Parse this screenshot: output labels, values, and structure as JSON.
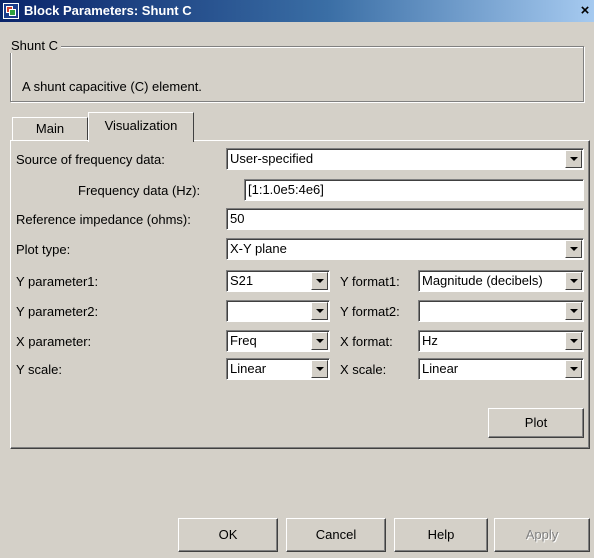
{
  "window": {
    "title": "Block Parameters: Shunt C",
    "close_label": "×"
  },
  "group": {
    "legend": "Shunt C",
    "description": "A shunt capacitive (C) element."
  },
  "tabs": [
    {
      "label": "Main",
      "selected": false
    },
    {
      "label": "Visualization",
      "selected": true
    }
  ],
  "form": {
    "source_label": "Source of frequency data:",
    "source_value": "User-specified",
    "freq_label": "Frequency data (Hz):",
    "freq_value": "[1:1.0e5:4e6]",
    "refimp_label": "Reference impedance (ohms):",
    "refimp_value": "50",
    "plottype_label": "Plot type:",
    "plottype_value": "X-Y plane",
    "yparam1_label": "Y parameter1:",
    "yparam1_value": "S21",
    "yformat1_label": "Y format1:",
    "yformat1_value": "Magnitude (decibels)",
    "yparam2_label": "Y parameter2:",
    "yparam2_value": "",
    "yformat2_label": "Y format2:",
    "yformat2_value": "",
    "xparam_label": "X parameter:",
    "xparam_value": "Freq",
    "xformat_label": "X format:",
    "xformat_value": "Hz",
    "yscale_label": "Y scale:",
    "yscale_value": "Linear",
    "xscale_label": "X scale:",
    "xscale_value": "Linear"
  },
  "buttons": {
    "plot": "Plot",
    "ok": "OK",
    "cancel": "Cancel",
    "help": "Help",
    "apply": "Apply"
  },
  "icons": {
    "app": "simulink-block-icon",
    "dropdown": "chevron-down-icon",
    "close": "close-icon"
  },
  "colors": {
    "titlebar_start": "#0a246a",
    "titlebar_end": "#a6caf0",
    "dialog_face": "#d4d0c8",
    "disabled_text": "#808080"
  }
}
